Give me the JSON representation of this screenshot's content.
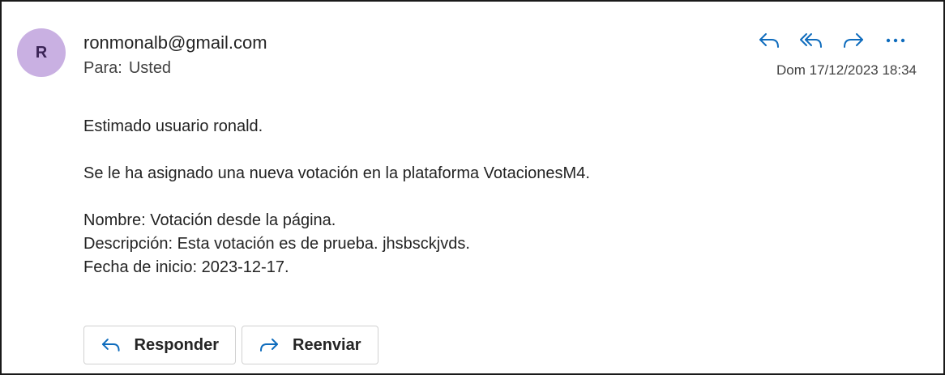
{
  "message": {
    "avatar_initial": "R",
    "sender": "ronmonalb@gmail.com",
    "to_label": "Para:",
    "to_value": "Usted",
    "date": "Dom 17/12/2023 18:34"
  },
  "toolbar": {
    "icons": [
      "reply-icon",
      "reply-all-icon",
      "forward-icon",
      "more-icon"
    ],
    "accent_color": "#0f6cbd"
  },
  "body": {
    "greeting": "Estimado usuario ronald.",
    "intro": "Se le ha asignado una nueva votación en la plataforma VotacionesM4.",
    "name_line": "Nombre: Votación desde la página.",
    "description_line": "Descripción: Esta votación es de prueba. jhsbsckjvds.",
    "start_date_line": "Fecha de inicio: 2023-12-17."
  },
  "footer": {
    "reply_label": "Responder",
    "forward_label": "Reenviar"
  }
}
